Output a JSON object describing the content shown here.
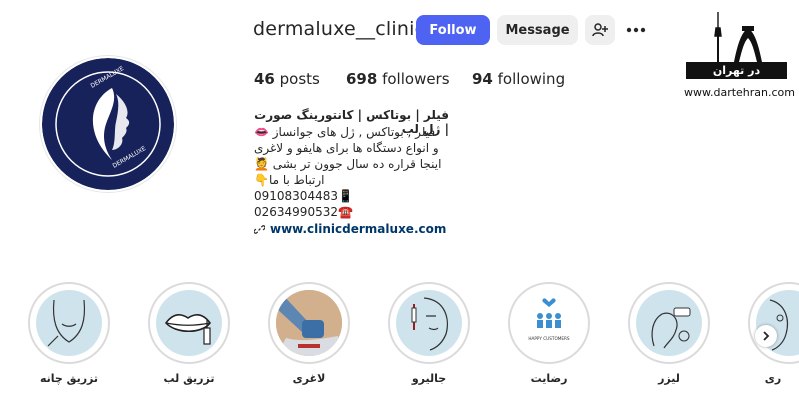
{
  "profile": {
    "username": "dermaluxe__clinic",
    "follow_label": "Follow",
    "message_label": "Message",
    "accent_color": "#4f63f2",
    "stats": {
      "posts_count": "46",
      "posts_label": "posts",
      "followers_count": "698",
      "followers_label": "followers",
      "following_count": "94",
      "following_label": "following"
    },
    "bio": {
      "title": "فیلر | بوتاکس | کانتورینگ صورت | ژل لب",
      "lines": [
        "فیلر , بوتاکس , ژل های جوانساز 👄",
        "و انواع دستگاه ها برای هایفو و لاغری",
        "اینجا قراره ده سال جوون تر بشی 💆",
        "ارتباط با ما👇",
        "09108304483📱",
        "02634990532☎️"
      ],
      "website": "www.clinicdermaluxe.com"
    },
    "avatar_text_top": "DERMALUXE",
    "avatar_text_bottom": "DERMALUXE"
  },
  "logo": {
    "band_text": "در تهران",
    "url": "www.dartehran.com"
  },
  "highlights": [
    {
      "label": "تزریق چانه",
      "icon": "chin-face-icon"
    },
    {
      "label": "تزریق لب",
      "icon": "lips-syringe-icon"
    },
    {
      "label": "لاغری",
      "icon": "slimming-device-icon"
    },
    {
      "label": "جالیرو",
      "icon": "face-needle-icon"
    },
    {
      "label": "رضایت",
      "icon": "happy-customers-icon",
      "caption": "HAPPY CUSTOMERS"
    },
    {
      "label": "لیزر",
      "icon": "laser-device-icon"
    },
    {
      "label": "ری",
      "icon": "partial-face-icon"
    }
  ]
}
